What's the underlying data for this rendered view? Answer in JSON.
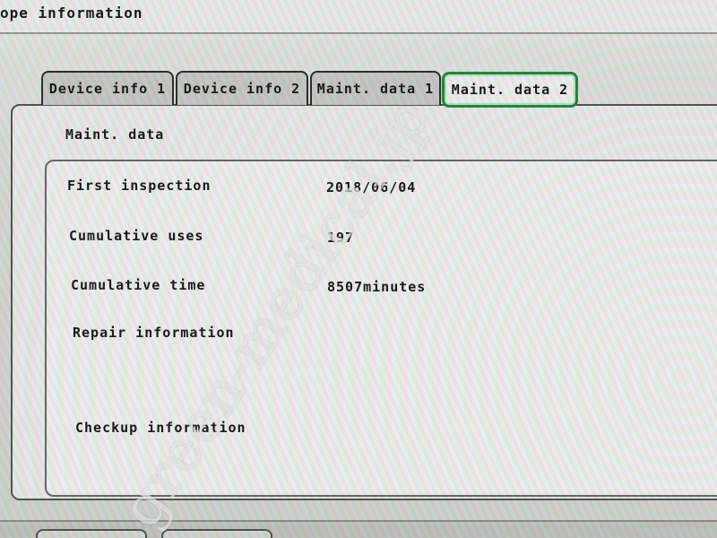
{
  "window": {
    "title": "ope information"
  },
  "tabs": [
    {
      "label": "Device info 1",
      "active": false
    },
    {
      "label": "Device info 2",
      "active": false
    },
    {
      "label": "Maint. data 1",
      "active": false
    },
    {
      "label": "Maint. data 2",
      "active": true
    }
  ],
  "panel": {
    "title": "Maint. data"
  },
  "fields": {
    "first_inspection": {
      "label": "First inspection",
      "value": "2018/06/04"
    },
    "cumulative_uses": {
      "label": "Cumulative uses",
      "value": "197"
    },
    "cumulative_time": {
      "label": "Cumulative time",
      "value": "8507",
      "unit": "minutes"
    },
    "repair_information": {
      "label": "Repair information",
      "value": ""
    },
    "checkup_information": {
      "label": "Checkup information",
      "value": ""
    }
  },
  "watermark": "green-medical.jp",
  "colors": {
    "active_tab_border": "#1f8f3a",
    "background": "#e6e8e4"
  }
}
